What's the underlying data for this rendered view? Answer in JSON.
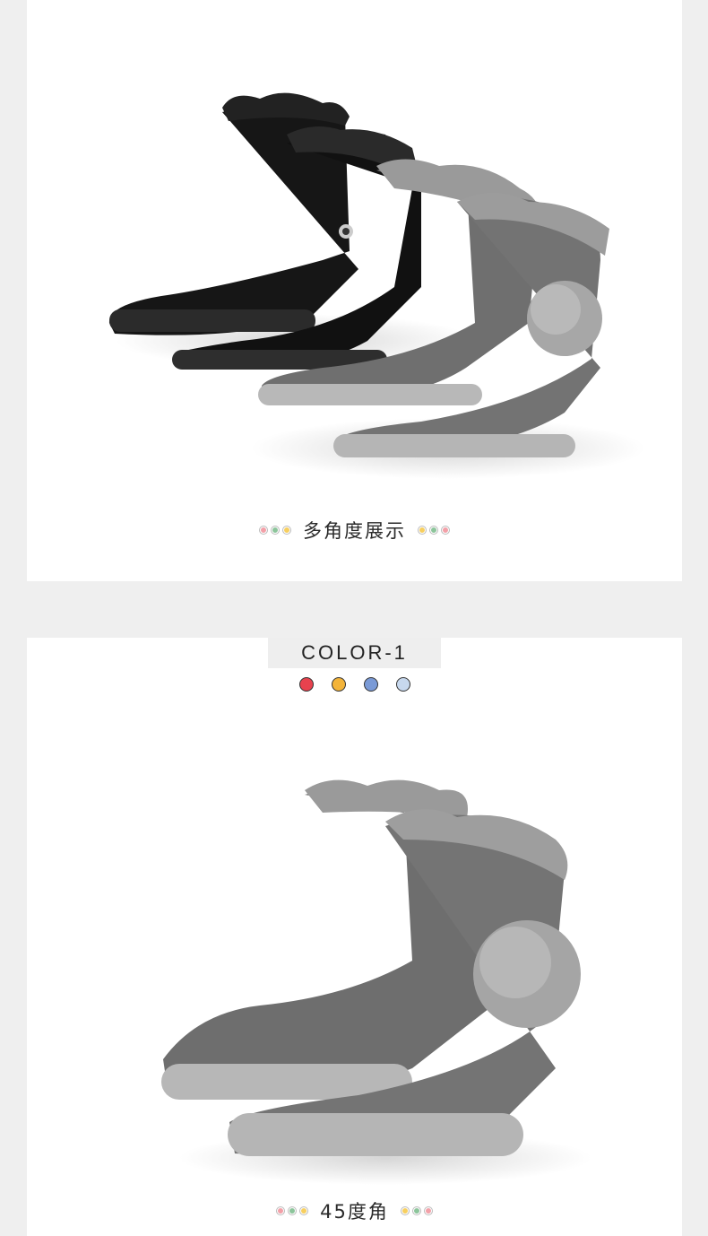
{
  "sections": [
    {
      "caption": "多角度展示",
      "dots_left": [
        "pink",
        "green",
        "yellow"
      ],
      "dots_right": [
        "yellow",
        "green",
        "pink"
      ]
    },
    {
      "tab_label": "COLOR-1",
      "swatches": [
        "#e8424e",
        "#f3b43a",
        "#7a9ad6",
        "#c7d8ee"
      ],
      "caption": "45度角",
      "dots_left": [
        "pink",
        "green",
        "yellow"
      ],
      "dots_right": [
        "yellow",
        "green",
        "pink"
      ]
    }
  ],
  "colors": {
    "boot_black": "#161616",
    "boot_grey": "#6f6f6f",
    "fur_grey": "#9a9a9a",
    "sole_grey": "#b8b8b8"
  }
}
